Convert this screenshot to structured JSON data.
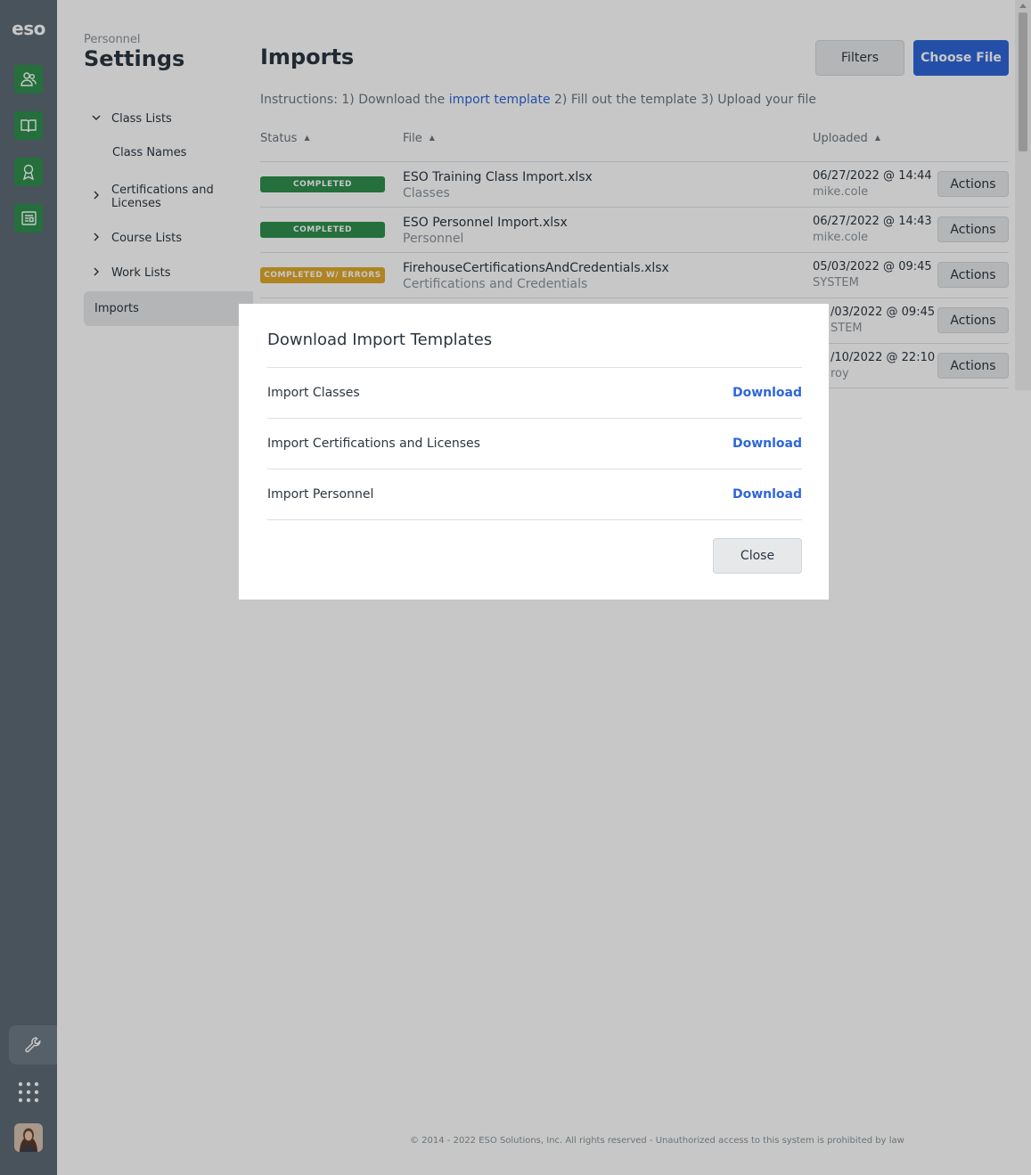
{
  "rail": {
    "logo": "eso",
    "icons": [
      "people-icon",
      "book-icon",
      "award-icon",
      "news-icon"
    ],
    "accent": "#2f8f4e"
  },
  "subnav": {
    "kicker": "Personnel",
    "title": "Settings",
    "items": [
      {
        "label": "Class Lists",
        "chevron": "down"
      },
      {
        "label": "Class Names",
        "chevron": ""
      },
      {
        "label": "Certifications and Licenses",
        "chevron": "right"
      },
      {
        "label": "Course Lists",
        "chevron": "right"
      },
      {
        "label": "Work Lists",
        "chevron": "right"
      },
      {
        "label": "Imports",
        "chevron": "",
        "active": true
      }
    ]
  },
  "main": {
    "title": "Imports",
    "filters_label": "Filters",
    "choose_file_label": "Choose File",
    "instructions": {
      "before": "Instructions: 1) Download the ",
      "link": "import template",
      "after": " 2) Fill out the template 3) Upload your file"
    },
    "columns": [
      "Status",
      "File",
      "Uploaded"
    ],
    "rows": [
      {
        "status": "COMPLETED",
        "status_color": "#2f8f4e",
        "file": "ESO Training Class Import.xlsx",
        "type": "Classes",
        "date": "06/27/2022 @ 14:44",
        "user": "mike.cole",
        "action": "Actions"
      },
      {
        "status": "COMPLETED",
        "status_color": "#2f8f4e",
        "file": "ESO Personnel Import.xlsx",
        "type": "Personnel",
        "date": "06/27/2022 @ 14:43",
        "user": "mike.cole",
        "action": "Actions"
      },
      {
        "status": "COMPLETED W/ ERRORS",
        "status_color": "#e0a92a",
        "file": "FirehouseCertificationsAndCredentials.xlsx",
        "type": "Certifications and Credentials",
        "date": "05/03/2022 @ 09:45",
        "user": "SYSTEM",
        "action": "Actions"
      },
      {
        "status": "",
        "status_color": "#2f8f4e",
        "file": "",
        "type": "",
        "date": "/03/2022 @ 09:45",
        "user": "STEM",
        "action": "Actions"
      },
      {
        "status": "",
        "status_color": "#2f8f4e",
        "file": "",
        "type": "",
        "date": "/10/2022 @ 22:10",
        "user": "roy",
        "action": "Actions"
      }
    ],
    "footer": "© 2014 - 2022 ESO Solutions, Inc. All rights reserved - Unauthorized access to this system is prohibited by law"
  },
  "modal": {
    "title": "Download Import Templates",
    "items": [
      {
        "label": "Import Classes",
        "action": "Download"
      },
      {
        "label": "Import Certifications and Licenses",
        "action": "Download"
      },
      {
        "label": "Import Personnel",
        "action": "Download"
      }
    ],
    "close_label": "Close"
  }
}
